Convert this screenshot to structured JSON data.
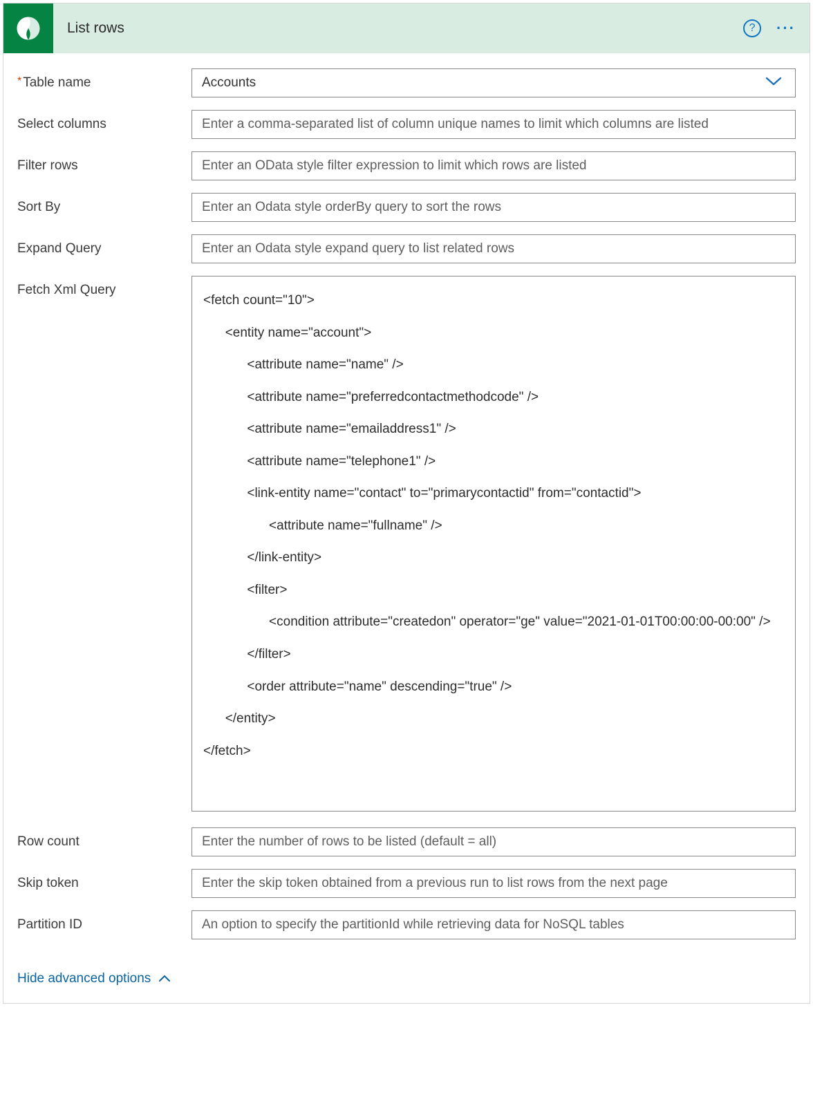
{
  "header": {
    "title": "List rows"
  },
  "fields": {
    "table_name": {
      "label": "Table name",
      "value": "Accounts"
    },
    "select_columns": {
      "label": "Select columns",
      "placeholder": "Enter a comma-separated list of column unique names to limit which columns are listed"
    },
    "filter_rows": {
      "label": "Filter rows",
      "placeholder": "Enter an OData style filter expression to limit which rows are listed"
    },
    "sort_by": {
      "label": "Sort By",
      "placeholder": "Enter an Odata style orderBy query to sort the rows"
    },
    "expand_query": {
      "label": "Expand Query",
      "placeholder": "Enter an Odata style expand query to list related rows"
    },
    "fetch_xml": {
      "label": "Fetch Xml Query",
      "value": "<fetch count=\"10\">\n      <entity name=\"account\">\n            <attribute name=\"name\" />\n            <attribute name=\"preferredcontactmethodcode\" />\n            <attribute name=\"emailaddress1\" />\n            <attribute name=\"telephone1\" />\n            <link-entity name=\"contact\" to=\"primarycontactid\" from=\"contactid\">\n                  <attribute name=\"fullname\" />\n            </link-entity>\n            <filter>\n                  <condition attribute=\"createdon\" operator=\"ge\" value=\"2021-01-01T00:00:00-00:00\" />\n            </filter>\n            <order attribute=\"name\" descending=\"true\" />\n      </entity>\n</fetch>"
    },
    "row_count": {
      "label": "Row count",
      "placeholder": "Enter the number of rows to be listed (default = all)"
    },
    "skip_token": {
      "label": "Skip token",
      "placeholder": "Enter the skip token obtained from a previous run to list rows from the next page"
    },
    "partition_id": {
      "label": "Partition ID",
      "placeholder": "An option to specify the partitionId while retrieving data for NoSQL tables"
    }
  },
  "toggle": {
    "label": "Hide advanced options"
  }
}
